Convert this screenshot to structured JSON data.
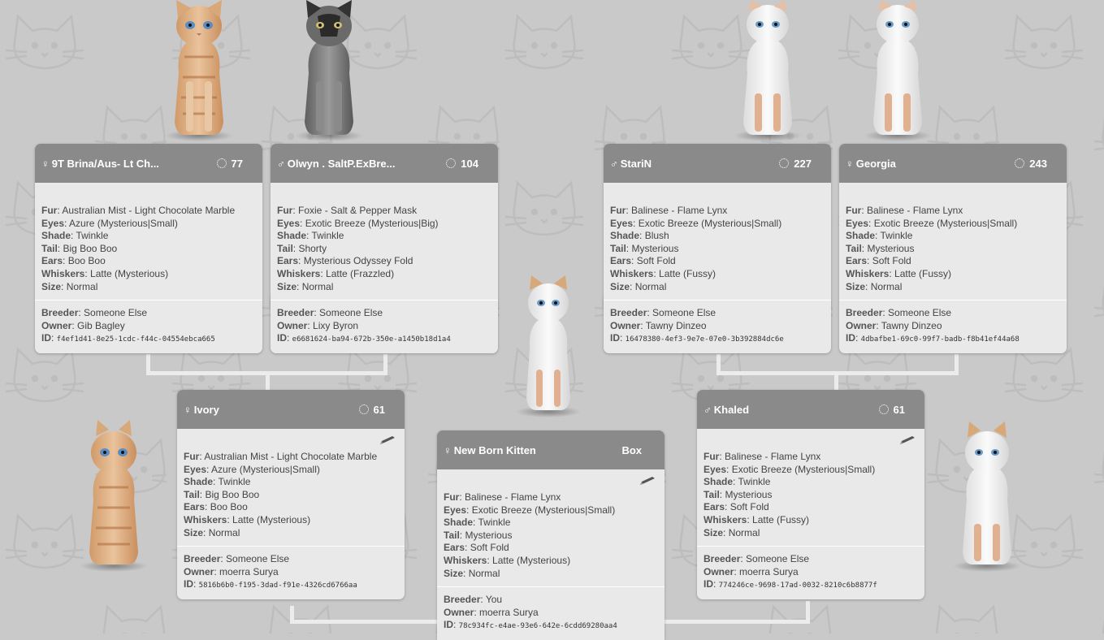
{
  "labels": {
    "fur": "Fur",
    "eyes": "Eyes",
    "shade": "Shade",
    "tail": "Tail",
    "ears": "Ears",
    "whiskers": "Whiskers",
    "size": "Size",
    "breeder": "Breeder",
    "owner": "Owner",
    "id": "ID"
  },
  "colors": {
    "header": "#8a8a8a",
    "card": "#e9e9e9",
    "background": "#c9c9c9",
    "connector": "#ececec"
  },
  "icons": {
    "female": "♀",
    "male": "♂",
    "level": "loading-spinner-icon",
    "edit": "pencil-icon",
    "background": "cat-face-pattern"
  },
  "grandparents": [
    {
      "sex": "♀",
      "name": "9T Brina/Aus- Lt Ch...",
      "level": "77",
      "fur": "Australian Mist - Light Chocolate Marble",
      "eyes": "Azure (Mysterious|Small)",
      "shade": "Twinkle",
      "tail": "Big Boo Boo",
      "ears": "Boo Boo",
      "whiskers": "Latte (Mysterious)",
      "size": "Normal",
      "breeder": "Someone Else",
      "owner": "Gib Bagley",
      "id": "f4ef1d41-8e25-1cdc-f44c-04554ebca665"
    },
    {
      "sex": "♂",
      "name": "Olwyn . SaltP.ExBre...",
      "level": "104",
      "fur": "Foxie - Salt & Pepper Mask",
      "eyes": "Exotic Breeze (Mysterious|Big)",
      "shade": "Twinkle",
      "tail": "Shorty",
      "ears": "Mysterious Odyssey Fold",
      "whiskers": "Latte (Frazzled)",
      "size": "Normal",
      "breeder": "Someone Else",
      "owner": "Lixy Byron",
      "id": "e6681624-ba94-672b-350e-a1450b18d1a4"
    },
    {
      "sex": "♂",
      "name": "StariN",
      "level": "227",
      "fur": "Balinese - Flame Lynx",
      "eyes": "Exotic Breeze (Mysterious|Small)",
      "shade": "Blush",
      "tail": "Mysterious",
      "ears": "Soft Fold",
      "whiskers": "Latte (Fussy)",
      "size": "Normal",
      "breeder": "Someone Else",
      "owner": "Tawny Dinzeo",
      "id": "16478380-4ef3-9e7e-07e0-3b392884dc6e"
    },
    {
      "sex": "♀",
      "name": "Georgia",
      "level": "243",
      "fur": "Balinese - Flame Lynx",
      "eyes": "Exotic Breeze (Mysterious|Small)",
      "shade": "Twinkle",
      "tail": "Mysterious",
      "ears": "Soft Fold",
      "whiskers": "Latte (Fussy)",
      "size": "Normal",
      "breeder": "Someone Else",
      "owner": "Tawny Dinzeo",
      "id": "4dbafbe1-69c0-99f7-badb-f8b41ef44a68"
    }
  ],
  "parents": [
    {
      "sex": "♀",
      "name": "Ivory",
      "level": "61",
      "fur": "Australian Mist - Light Chocolate Marble",
      "eyes": "Azure (Mysterious|Small)",
      "shade": "Twinkle",
      "tail": "Big Boo Boo",
      "ears": "Boo Boo",
      "whiskers": "Latte (Mysterious)",
      "size": "Normal",
      "breeder": "Someone Else",
      "owner": "moerra Surya",
      "id": "5816b6b0-f195-3dad-f91e-4326cd6766aa"
    },
    {
      "sex": "♂",
      "name": "Khaled",
      "level": "61",
      "fur": "Balinese - Flame Lynx",
      "eyes": "Exotic Breeze (Mysterious|Small)",
      "shade": "Twinkle",
      "tail": "Mysterious",
      "ears": "Soft Fold",
      "whiskers": "Latte (Fussy)",
      "size": "Normal",
      "breeder": "Someone Else",
      "owner": "moerra Surya",
      "id": "774246ce-9698-17ad-0032-8210c6b8877f"
    }
  ],
  "kitten": {
    "sex": "♀",
    "name": "New Born Kitten",
    "level": "Box",
    "fur": "Balinese - Flame Lynx",
    "eyes": "Exotic Breeze (Mysterious|Small)",
    "shade": "Twinkle",
    "tail": "Mysterious",
    "ears": "Soft Fold",
    "whiskers": "Latte (Mysterious)",
    "size": "Normal",
    "breeder": "You",
    "owner": "moerra Surya",
    "id": "78c934fc-e4ae-93e6-642e-6cdd69280aa4"
  }
}
